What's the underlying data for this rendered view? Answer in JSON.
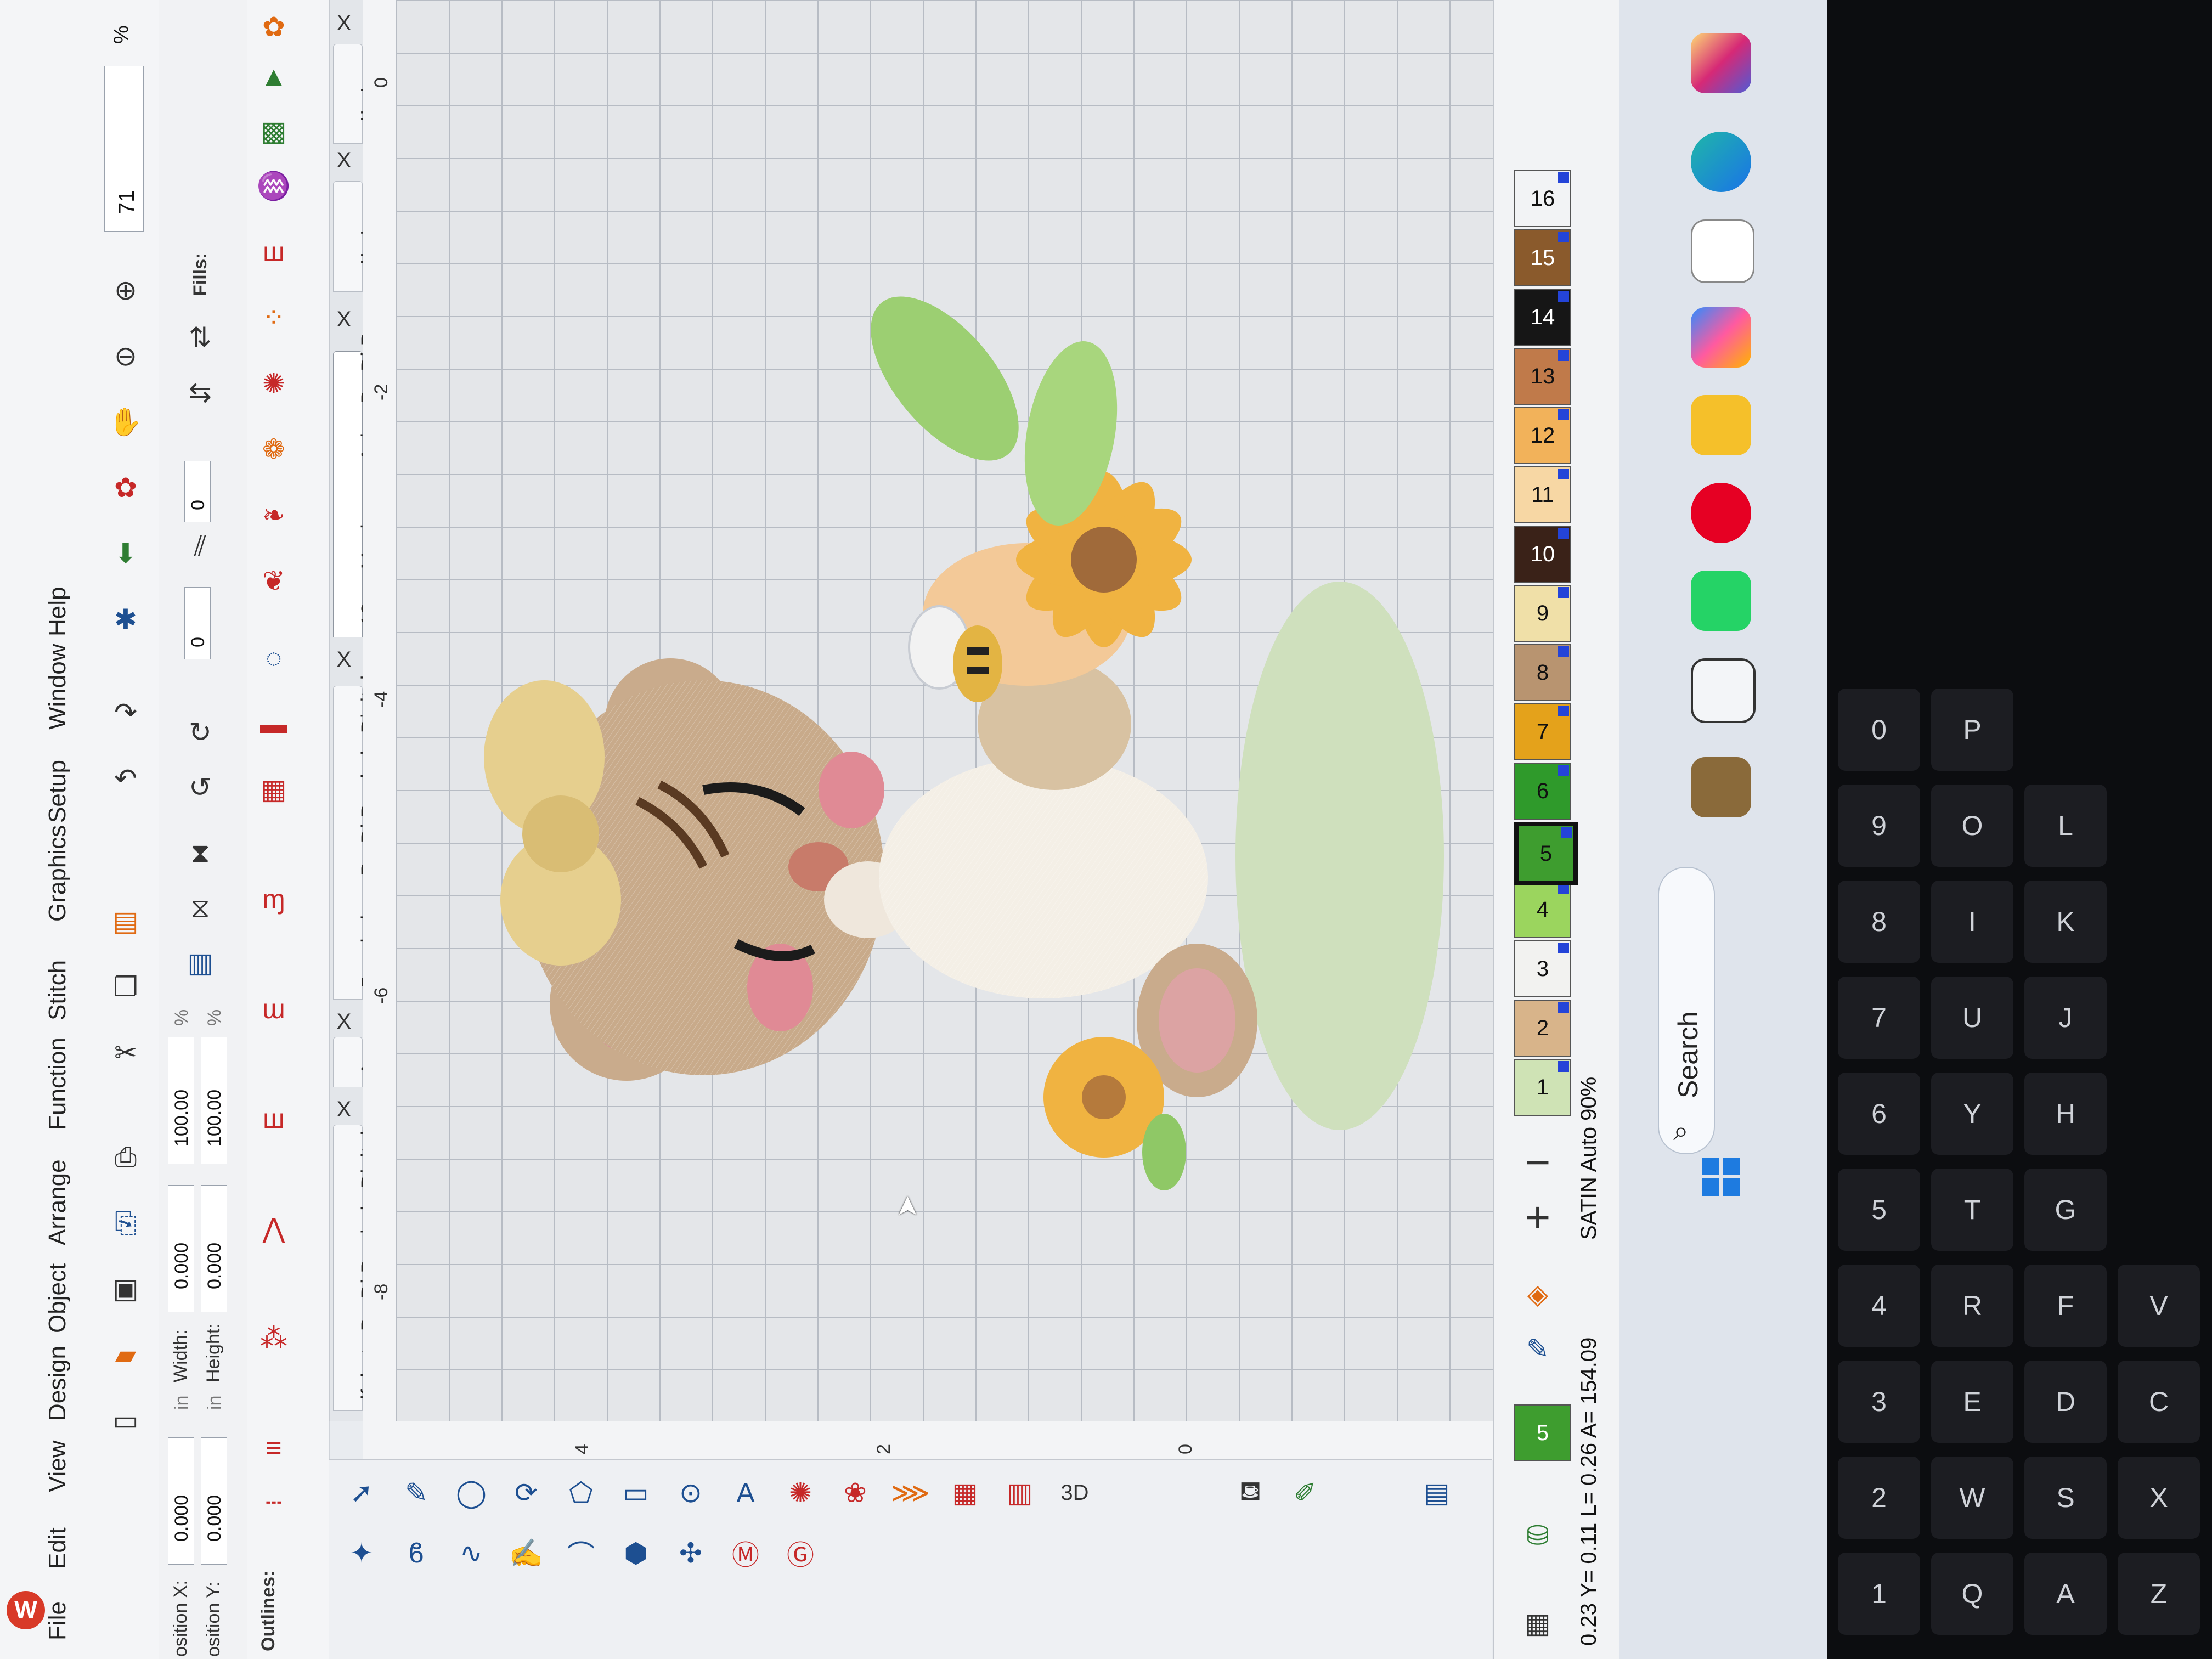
{
  "menu": {
    "items": [
      "File",
      "Edit",
      "View",
      "Design",
      "Object",
      "Arrange",
      "Function",
      "Stitch",
      "Graphics",
      "Setup",
      "Window",
      "Help"
    ]
  },
  "properties": {
    "position_x_label": "osition X:",
    "position_x_value": "0.000",
    "position_y_label": "osition Y:",
    "position_y_value": "0.000",
    "width_label": "Width:",
    "width_value": "0.000",
    "height_label": "Height:",
    "height_value": "0.000",
    "scale_x": "100.00",
    "scale_y": "100.00",
    "unit": "in",
    "percent": "%",
    "rotation": "0",
    "slant": "0",
    "zoom": "71",
    "outlines_label": "Outlines:",
    "fills_label": "Fills:"
  },
  "tabs": [
    {
      "label": "lfabeto BorDi Bordado Digital...",
      "close": "X"
    },
    {
      "label": "A",
      "close": "X"
    },
    {
      "label": "5cm baloes BorDi Bordado Digital...",
      "close": "X"
    },
    {
      "label": "12cm Menino em Aviao BorDi Bor...",
      "close": "X"
    },
    {
      "label": "ابطار",
      "close": "X"
    },
    {
      "label": "ابطار",
      "close": "X"
    }
  ],
  "ruler": {
    "vertical_ticks": [
      "-8",
      "-6",
      "-4",
      "-2",
      "0"
    ],
    "horizontal_ticks": [
      "4",
      "2",
      "0"
    ]
  },
  "colorbar": {
    "swatches": [
      {
        "num": "1",
        "color": "#cfe3b5"
      },
      {
        "num": "2",
        "color": "#d8b48a"
      },
      {
        "num": "3",
        "color": "#f2f2f0"
      },
      {
        "num": "4",
        "color": "#9bd55e"
      },
      {
        "num": "5",
        "color": "#3e9d2f"
      },
      {
        "num": "6",
        "color": "#2f9a2b"
      },
      {
        "num": "7",
        "color": "#e4a21b"
      },
      {
        "num": "8",
        "color": "#b89470"
      },
      {
        "num": "9",
        "color": "#f0e0a8"
      },
      {
        "num": "10",
        "color": "#3a2218"
      },
      {
        "num": "11",
        "color": "#f7d7a4"
      },
      {
        "num": "12",
        "color": "#f2b25a"
      },
      {
        "num": "13",
        "color": "#c07a4a"
      },
      {
        "num": "14",
        "color": "#161616"
      },
      {
        "num": "15",
        "color": "#8a5a2c"
      },
      {
        "num": "16",
        "color": "#f2f3f5"
      }
    ],
    "current_color": "5",
    "selected_index": 4,
    "add_symbol": "+",
    "remove_symbol": "−"
  },
  "status": {
    "stitch_type": "SATIN Auto 90%",
    "coords": "0.23 Y= 0.11 L= 0.26 A= 154.09"
  },
  "taskbar": {
    "search": "Search",
    "icons": [
      "windows-start-icon",
      "search-icon",
      "explorer-app-icon",
      "task-view-icon",
      "whatsapp-icon",
      "pinterest-icon",
      "file-explorer-icon",
      "copilot-icon",
      "microsoft-store-icon",
      "edge-icon",
      "instagram-icon"
    ]
  },
  "keyboard": {
    "row1": [
      "1",
      "2",
      "3",
      "4",
      "5",
      "6",
      "7",
      "8",
      "9",
      "0"
    ],
    "row2": [
      "Q",
      "W",
      "E",
      "R",
      "T",
      "Y",
      "U",
      "I",
      "O",
      "P"
    ],
    "row3": [
      "A",
      "S",
      "D",
      "F",
      "G",
      "H",
      "J",
      "K",
      "L"
    ],
    "row4": [
      "Z",
      "X",
      "C",
      "V"
    ]
  }
}
